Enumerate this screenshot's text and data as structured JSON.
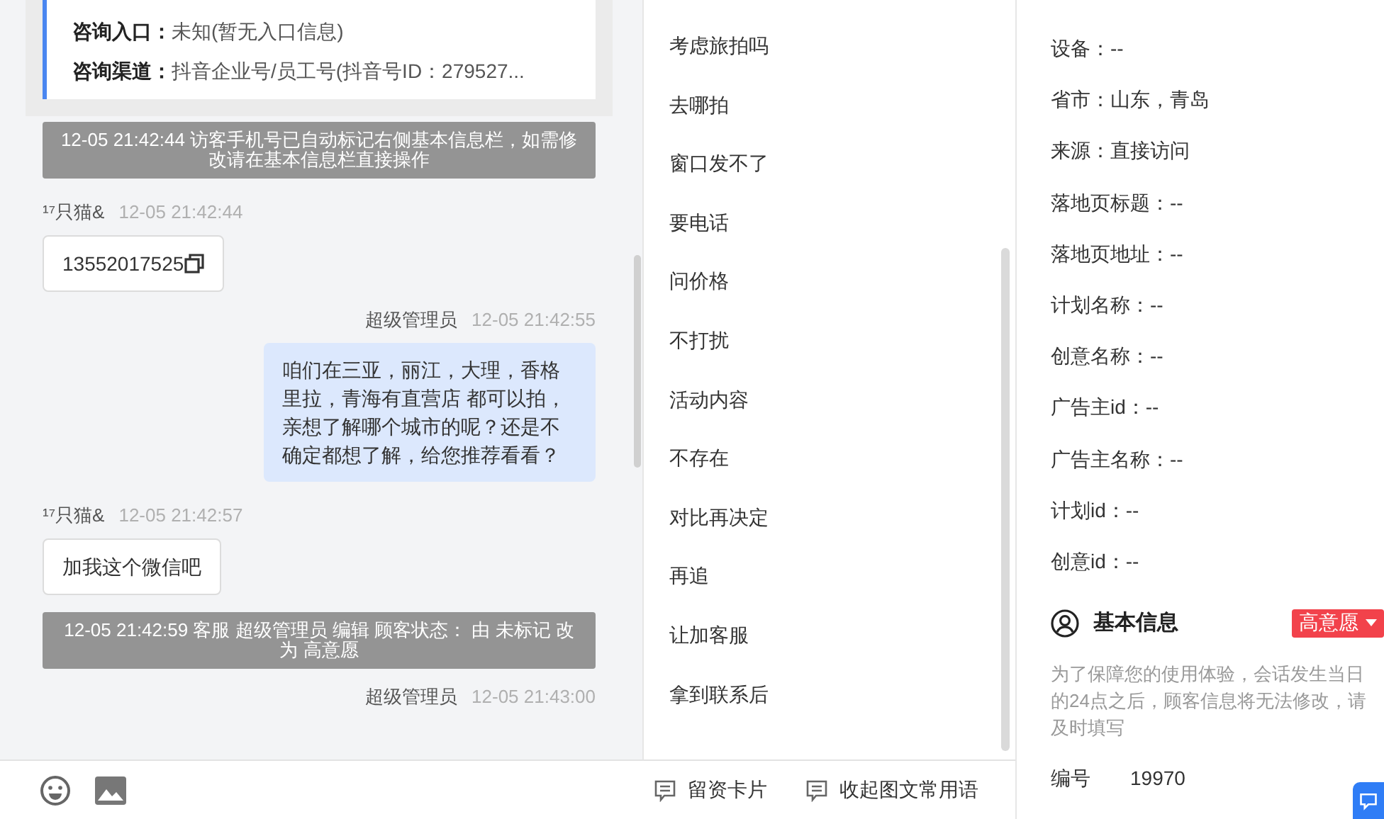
{
  "consult_card": {
    "rows": [
      {
        "label": "咨询入口：",
        "value": "未知(暂无入口信息)"
      },
      {
        "label": "咨询渠道：",
        "value": "抖音企业号/员工号(抖音号ID：279527..."
      }
    ]
  },
  "messages": [
    {
      "kind": "system",
      "text": "12-05 21:42:44 访客手机号已自动标记右侧基本信息栏，如需修改请在基本信息栏直接操作"
    },
    {
      "kind": "visitor",
      "sender": "¹⁷只猫&",
      "time": "12-05 21:42:44",
      "text": "13552017525",
      "copyable": true
    },
    {
      "kind": "agent",
      "sender": "超级管理员",
      "time": "12-05 21:42:55",
      "text": "咱们在三亚，丽江，大理，香格里拉，青海有直营店 都可以拍，亲想了解哪个城市的呢？还是不确定都想了解，给您推荐看看？"
    },
    {
      "kind": "visitor",
      "sender": "¹⁷只猫&",
      "time": "12-05 21:42:57",
      "text": "加我这个微信吧",
      "copyable": false
    },
    {
      "kind": "system",
      "text": "12-05 21:42:59 客服 超级管理员 编辑 顾客状态： 由 未标记 改为 高意愿"
    },
    {
      "kind": "agent_header",
      "sender": "超级管理员",
      "time": "12-05 21:43:00"
    }
  ],
  "quick_replies": [
    "考虑旅拍吗",
    "去哪拍",
    "窗口发不了",
    "要电话",
    "问价格",
    "不打扰",
    "活动内容",
    "不存在",
    "对比再决定",
    "再追",
    "让加客服",
    "拿到联系后"
  ],
  "toolbar": {
    "buttons": [
      "留资卡片",
      "收起图文常用语"
    ]
  },
  "visitor_info": [
    "设备：--",
    "省市：山东，青岛",
    "来源：直接访问",
    "落地页标题：--",
    "落地页地址：--",
    "计划名称：--",
    "创意名称：--",
    "广告主id：--",
    "广告主名称：--",
    "计划id：--",
    "创意id：--"
  ],
  "basic_info": {
    "title": "基本信息",
    "status_tag": {
      "label": "高意愿",
      "color": "#f2424b"
    },
    "notice": "为了保障您的使用体验，会话发生当日的24点之后，顾客信息将无法修改，请及时填写",
    "fields": [
      {
        "label": "编号",
        "value": "19970"
      }
    ]
  }
}
